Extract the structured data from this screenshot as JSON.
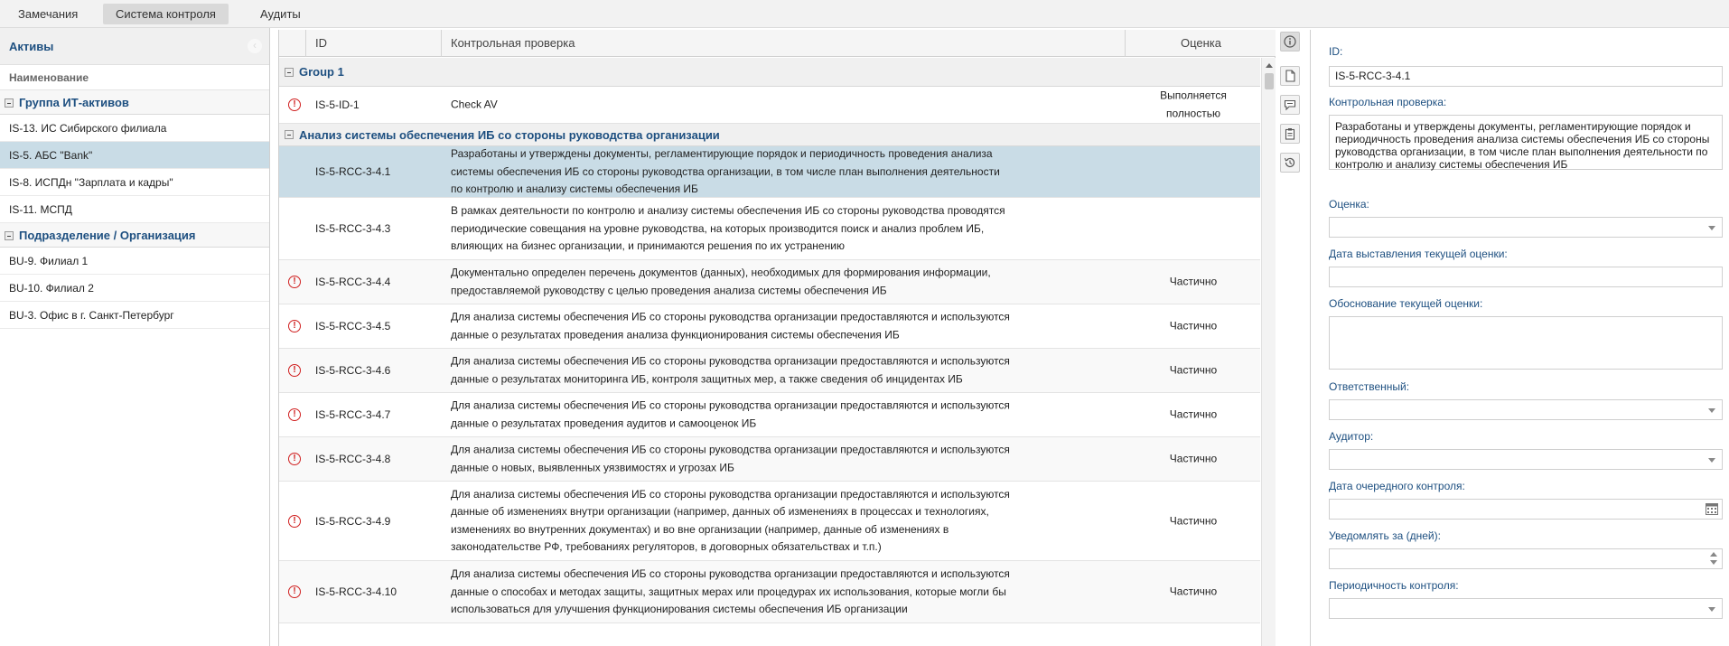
{
  "tabs": [
    {
      "label": "Замечания",
      "active": false
    },
    {
      "label": "Система контроля",
      "active": true
    },
    {
      "label": "Аудиты",
      "active": false
    }
  ],
  "left_panel": {
    "title": "Активы",
    "column_header": "Наименование",
    "groups": [
      {
        "label": "Группа ИТ-активов",
        "items": [
          {
            "label": "IS-13. ИС Сибирского филиала"
          },
          {
            "label": "IS-5. АБС \"Bank\"",
            "selected": true
          },
          {
            "label": "IS-8. ИСПДн \"Зарплата и кадры\""
          },
          {
            "label": "IS-11. МСПД"
          }
        ]
      },
      {
        "label": "Подразделение / Организация",
        "items": [
          {
            "label": "BU-9. Филиал 1"
          },
          {
            "label": "BU-10. Филиал 2"
          },
          {
            "label": "BU-3. Офис в г. Санкт-Петербург"
          }
        ]
      }
    ]
  },
  "grid": {
    "columns": {
      "id": "ID",
      "check": "Контрольная проверка",
      "score": "Оценка"
    },
    "group1": {
      "label": "Group 1",
      "rows": [
        {
          "id": "IS-5-ID-1",
          "desc": "Check AV",
          "score": "Выполняется полностью",
          "warning": true
        }
      ]
    },
    "group2": {
      "label": "Анализ системы обеспечения ИБ со стороны руководства организации",
      "rows": [
        {
          "id": "IS-5-RCC-3-4.1",
          "desc": "Разработаны и утверждены документы, регламентирующие порядок и периодичность проведения анализа системы обеспечения ИБ со стороны руководства организации, в том числе план выполнения деятельности по контролю и анализу системы обеспечения ИБ",
          "score": "",
          "warning": false,
          "selected": true
        },
        {
          "id": "IS-5-RCC-3-4.3",
          "desc": "В рамках деятельности по контролю и анализу системы обеспечения ИБ со стороны руководства проводятся периодические совещания на уровне руководства, на которых производится поиск и анализ проблем ИБ, влияющих на бизнес организации, и принимаются решения по их устранению",
          "score": "",
          "warning": false
        },
        {
          "id": "IS-5-RCC-3-4.4",
          "desc": "Документально определен перечень документов (данных), необходимых для формирования информации, предоставляемой руководству с целью проведения анализа системы обеспечения ИБ",
          "score": "Частично",
          "warning": true
        },
        {
          "id": "IS-5-RCC-3-4.5",
          "desc": "Для анализа системы обеспечения ИБ со стороны руководства организации предоставляются и используются данные о результатах проведения анализа функционирования системы обеспечения ИБ",
          "score": "Частично",
          "warning": true
        },
        {
          "id": "IS-5-RCC-3-4.6",
          "desc": "Для анализа системы обеспечения ИБ со стороны руководства организации предоставляются и используются данные о результатах мониторинга ИБ, контроля защитных мер, а также сведения об инцидентах ИБ",
          "score": "Частично",
          "warning": true
        },
        {
          "id": "IS-5-RCC-3-4.7",
          "desc": "Для анализа системы обеспечения ИБ со стороны руководства организации предоставляются и используются данные о результатах проведения аудитов и самооценок ИБ",
          "score": "Частично",
          "warning": true
        },
        {
          "id": "IS-5-RCC-3-4.8",
          "desc": "Для анализа системы обеспечения ИБ со стороны руководства организации предоставляются и используются данные о новых, выявленных уязвимостях и угрозах ИБ",
          "score": "Частично",
          "warning": true
        },
        {
          "id": "IS-5-RCC-3-4.9",
          "desc": "Для анализа системы обеспечения ИБ со стороны руководства организации предоставляются и используются данные об изменениях внутри организации (например, данных об изменениях в процессах и технологиях, изменениях во внутренних документах) и во вне организации (например, данные об изменениях в законодательстве РФ, требованиях регуляторов, в договорных обязательствах и т.п.)",
          "score": "Частично",
          "warning": true
        },
        {
          "id": "IS-5-RCC-3-4.10",
          "desc": "Для анализа системы обеспечения ИБ со стороны руководства организации предоставляются и используются данные о способах и методах защиты, защитных мерах или процедурах их использования, которые могли бы использоваться для улучшения функционирования системы обеспечения ИБ организации",
          "score": "Частично",
          "warning": true
        }
      ]
    }
  },
  "toolbar": {
    "icons": [
      "info-icon",
      "document-icon",
      "comment-icon",
      "clipboard-icon",
      "history-icon"
    ]
  },
  "form": {
    "id_label": "ID:",
    "id_value": "IS-5-RCC-3-4.1",
    "check_label": "Контрольная проверка:",
    "check_value": "Разработаны и утверждены документы, регламентирующие порядок и периодичность проведения анализа системы обеспечения ИБ со стороны руководства организации, в том числе план выполнения деятельности по контролю и анализу системы обеспечения ИБ",
    "score_label": "Оценка:",
    "score_value": "",
    "date_label": "Дата выставления текущей оценки:",
    "date_value": "",
    "reason_label": "Обоснование текущей оценки:",
    "reason_value": "",
    "responsible_label": "Ответственный:",
    "responsible_value": "",
    "auditor_label": "Аудитор:",
    "auditor_value": "",
    "next_date_label": "Дата очередного контроля:",
    "next_date_value": "",
    "notify_label": "Уведомлять за (дней):",
    "notify_value": "",
    "period_label": "Периодичность контроля:",
    "period_value": ""
  },
  "colors": {
    "accent": "#1d4f80",
    "selection": "#c9dce6",
    "warning": "#d02020"
  }
}
